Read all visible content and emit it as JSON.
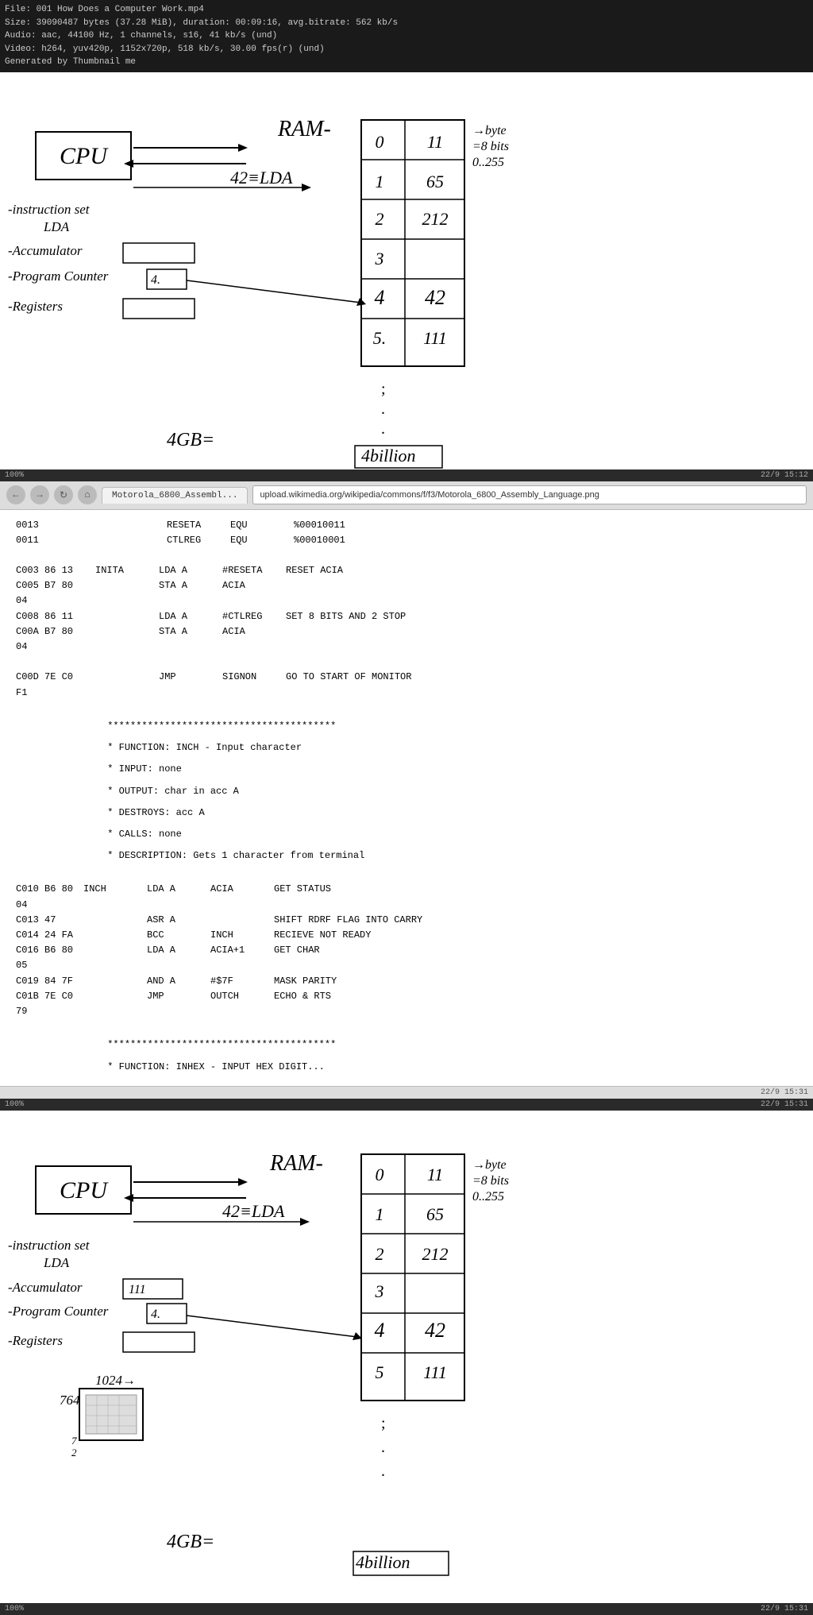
{
  "video_info": {
    "file": "File: 001 How Does a Computer Work.mp4",
    "size": "Size: 39090487 bytes (37.28 MiB), duration: 00:09:16, avg.bitrate: 562 kb/s",
    "audio": "Audio: aac, 44100 Hz, 1 channels, s16, 41 kb/s (und)",
    "video": "Video: h264, yuv420p, 1152x720p, 518 kb/s, 30.00 fps(r) (und)",
    "generated": "Generated by Thumbnail me"
  },
  "video_statusbar1": {
    "left": "100%",
    "right": "22/9 15:12"
  },
  "browser": {
    "tab_label": "Motorola_6800_Assembl...",
    "url": "upload.wikimedia.org/wikipedia/commons/f/f3/Motorola_6800_Assembly_Language.png",
    "status_left": "",
    "status_right": "22/9 15:31"
  },
  "assembly": {
    "equates": [
      {
        "addr": "0013",
        "label": "RESETA",
        "op": "EQU",
        "operand": "%00010011"
      },
      {
        "addr": "0011",
        "label": "CTLREG",
        "op": "EQU",
        "operand": "%00010001"
      }
    ],
    "inita_block": [
      {
        "addr": "C003 86 13",
        "label": "INITA",
        "op": "LDA A",
        "operand": "#RESETA",
        "comment": "RESET ACIA"
      },
      {
        "addr": "C005 B7 80 04",
        "label": "",
        "op": "STA A",
        "operand": "ACIA",
        "comment": ""
      },
      {
        "addr": "C008 86 11",
        "label": "",
        "op": "LDA A",
        "operand": "#CTLREG",
        "comment": "SET 8 BITS AND 2 STOP"
      },
      {
        "addr": "C00A B7 80 04",
        "label": "",
        "op": "STA A",
        "operand": "ACIA",
        "comment": ""
      }
    ],
    "jmp_line": {
      "addr": "C00D 7E C0 F1",
      "op": "JMP",
      "operand": "SIGNON",
      "comment": "GO TO START OF MONITOR"
    },
    "inch_block": [
      {
        "addr": "C010 B6 80 04",
        "label": "INCH",
        "op": "LDA A",
        "operand": "ACIA",
        "comment": "GET STATUS"
      },
      {
        "addr": "C013 47",
        "label": "",
        "op": "ASR A",
        "operand": "",
        "comment": "SHIFT RDRF FLAG INTO CARRY"
      },
      {
        "addr": "C014 24 FA",
        "label": "",
        "op": "BCC",
        "operand": "INCH",
        "comment": "RECIEVE NOT READY"
      },
      {
        "addr": "C016 B6 80 05",
        "label": "",
        "op": "LDA A",
        "operand": "ACIA+1",
        "comment": "GET CHAR"
      },
      {
        "addr": "C019 84 7F",
        "label": "",
        "op": "AND A",
        "operand": "#$7F",
        "comment": "MASK PARITY"
      },
      {
        "addr": "C01B 7E C0 79",
        "label": "",
        "op": "JMP",
        "operand": "OUTCH",
        "comment": "ECHO & RTS"
      }
    ],
    "inch_comments": [
      "* FUNCTION: INCH - Input character",
      "* INPUT: none",
      "* OUTPUT: char in acc A",
      "* DESTROYS: acc A",
      "* CALLS: none",
      "* DESCRIPTION: Gets 1 character from terminal"
    ],
    "stars": "****************************************",
    "bottom_stars": "****************************************",
    "bottom_partial": "* FUNCTION: INHEX - INPUT HEX DIGIT..."
  },
  "video_statusbar2": {
    "left": "100%",
    "right": "22/9 15:31"
  },
  "diagram1": {
    "cpu_label": "CPU",
    "ram_label": "RAM-",
    "lda_label": "42≡LDA",
    "instruction_set": "-instruction set",
    "lda_sub": "LDA",
    "accumulator": "-Accumulator",
    "program_counter": "-Program Counter",
    "registers": "-Registers",
    "gb_label": "4GB=",
    "billion_label": "4billion",
    "byte_label": "→byte",
    "bits_label": "=8 bits",
    "range_label": "0..255",
    "table": {
      "rows": [
        {
          "addr": "0",
          "val": "11"
        },
        {
          "addr": "1",
          "val": "65"
        },
        {
          "addr": "2",
          "val": "212"
        },
        {
          "addr": "3",
          "val": ""
        },
        {
          "addr": "4",
          "val": "42"
        },
        {
          "addr": "5",
          "val": "111"
        }
      ]
    }
  },
  "diagram2": {
    "cpu_label": "CPU",
    "ram_label": "RAM-",
    "lda_label": "42≡LDA",
    "instruction_set": "-instruction set",
    "lda_sub": "LDA",
    "accumulator": "-Accumulator",
    "program_counter": "-Program Counter",
    "registers": "-Registers",
    "gb_label": "4GB=",
    "billion_label": "4billion",
    "byte_label": "→byte",
    "bits_label": "=8 bits",
    "range_label": "0..255",
    "extra_label": "1024→",
    "extra_num": "764",
    "acc_value": "111",
    "pc_value": "4.",
    "table": {
      "rows": [
        {
          "addr": "0",
          "val": "11"
        },
        {
          "addr": "1",
          "val": "65"
        },
        {
          "addr": "2",
          "val": "212"
        },
        {
          "addr": "3",
          "val": ""
        },
        {
          "addr": "4",
          "val": "42"
        },
        {
          "addr": "5",
          "val": "111"
        }
      ]
    }
  }
}
